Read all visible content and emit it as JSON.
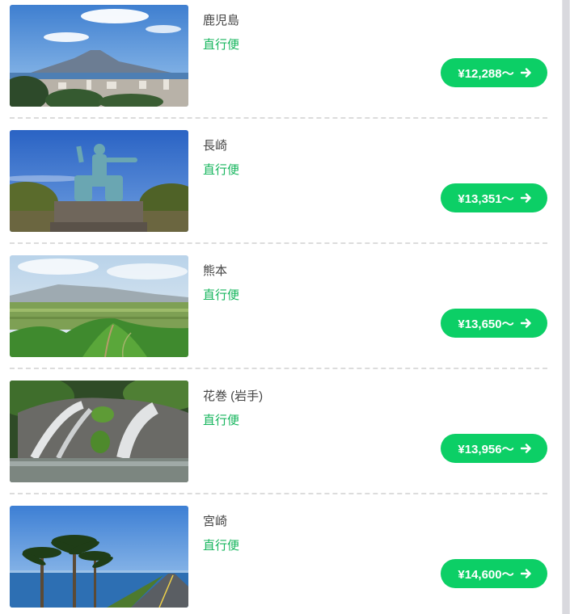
{
  "destinations": [
    {
      "city": "鹿児島",
      "flight_type": "直行便",
      "price": "¥12,288〜",
      "photo": "sakurajima-volcano-city"
    },
    {
      "city": "長崎",
      "flight_type": "直行便",
      "price": "¥13,351〜",
      "photo": "peace-statue"
    },
    {
      "city": "熊本",
      "flight_type": "直行便",
      "price": "¥13,650〜",
      "photo": "aso-green-hills"
    },
    {
      "city": "花巻 (岩手)",
      "flight_type": "直行便",
      "price": "¥13,956〜",
      "photo": "waterfall"
    },
    {
      "city": "宮崎",
      "flight_type": "直行便",
      "price": "¥14,600〜",
      "photo": "palm-trees-coast-road"
    }
  ],
  "colors": {
    "accent": "#0ccf66",
    "flight_type_text": "#17b65e",
    "city_text": "#444444",
    "divider": "#dcdcdc"
  }
}
